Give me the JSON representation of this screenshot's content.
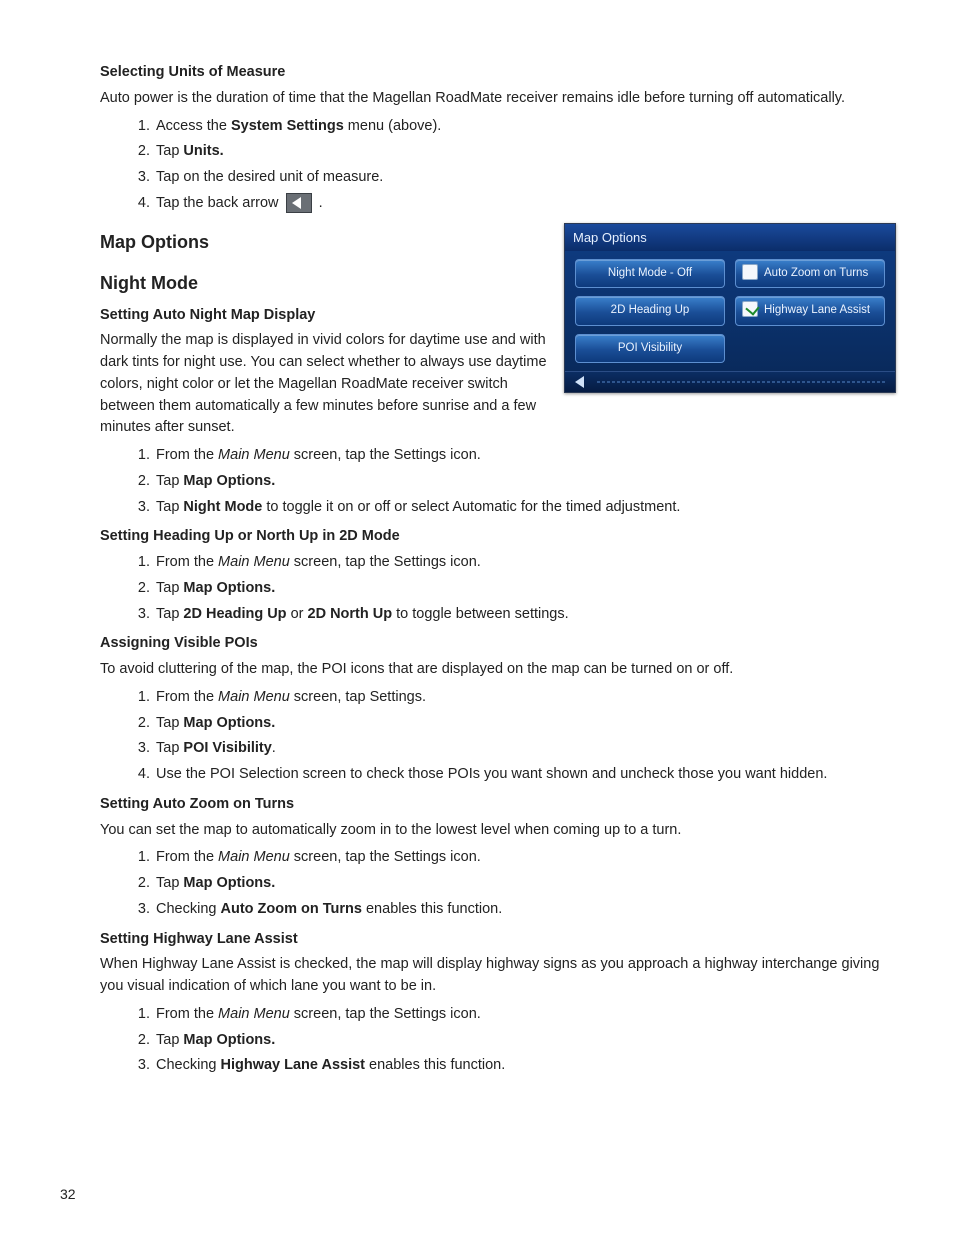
{
  "pageNumber": "32",
  "section1": {
    "title": "Selecting Units of Measure",
    "para": "Auto power is the duration of time that the Magellan RoadMate receiver remains idle before turning off automatically.",
    "steps": {
      "s1a": "Access the ",
      "s1b": "System Settings",
      "s1c": " menu (above).",
      "s2a": "Tap ",
      "s2b": "Units.",
      "s3": "Tap on the desired unit of measure.",
      "s4a": "Tap the back arrow ",
      "s4b": " ."
    }
  },
  "mapOptions": {
    "h2a": "Map Options",
    "h2b": "Night Mode",
    "sub1": "Setting Auto Night Map Display",
    "para1": "Normally the map is displayed in vivid colors for daytime use and with dark tints for night use. You can select whether to always use daytime colors, night color or let the Magellan RoadMate receiver switch between them automatically a few minutes before sunrise and a few minutes after sunset.",
    "steps1": {
      "s1a": "From the ",
      "s1b": "Main Menu",
      "s1c": " screen, tap the Settings icon.",
      "s2a": "Tap ",
      "s2b": "Map Options.",
      "s3a": "Tap ",
      "s3b": "Night Mode",
      "s3c": " to toggle it on or off or select Automatic for the timed adjustment."
    },
    "sub2": "Setting Heading Up or North Up in 2D Mode",
    "steps2": {
      "s1a": "From the ",
      "s1b": "Main Menu",
      "s1c": " screen, tap the Settings icon.",
      "s2a": "Tap ",
      "s2b": "Map Options.",
      "s3a": "Tap ",
      "s3b": "2D Heading Up",
      "s3c": " or ",
      "s3d": "2D North Up",
      "s3e": " to toggle between settings."
    },
    "sub3": "Assigning Visible POIs",
    "para3": "To avoid cluttering of the map, the POI icons that are displayed on the map can be turned on or off.",
    "steps3": {
      "s1a": "From the ",
      "s1b": "Main Menu",
      "s1c": " screen, tap Settings.",
      "s2a": "Tap ",
      "s2b": "Map Options.",
      "s3a": "Tap ",
      "s3b": "POI Visibility",
      "s3c": ".",
      "s4": "Use the POI Selection screen to check those POIs you want shown and uncheck those you want hidden."
    },
    "sub4": "Setting Auto Zoom on Turns",
    "para4": "You can set the map to automatically zoom in to the lowest level when coming up to a turn.",
    "steps4": {
      "s1a": "From the ",
      "s1b": "Main Menu",
      "s1c": " screen, tap the Settings icon.",
      "s2a": "Tap ",
      "s2b": "Map Options.",
      "s3a": "Checking ",
      "s3b": "Auto Zoom on Turns",
      "s3c": " enables this function."
    },
    "sub5": "Setting Highway Lane Assist",
    "para5": "When Highway Lane Assist is checked, the map will display highway signs as you approach a highway interchange giving you visual indication of which lane you want to be in.",
    "steps5": {
      "s1a": "From the ",
      "s1b": "Main Menu",
      "s1c": " screen, tap the Settings icon.",
      "s2a": "Tap ",
      "s2b": "Map Options.",
      "s3a": "Checking ",
      "s3b": "Highway Lane Assist",
      "s3c": " enables this function."
    }
  },
  "figure": {
    "title": "Map Options",
    "btnNightMode": "Night Mode - Off",
    "btnHeading": "2D Heading Up",
    "btnPoi": "POI Visibility",
    "btnAutoZoom": "Auto Zoom on Turns",
    "btnHighway": "Highway Lane Assist"
  }
}
